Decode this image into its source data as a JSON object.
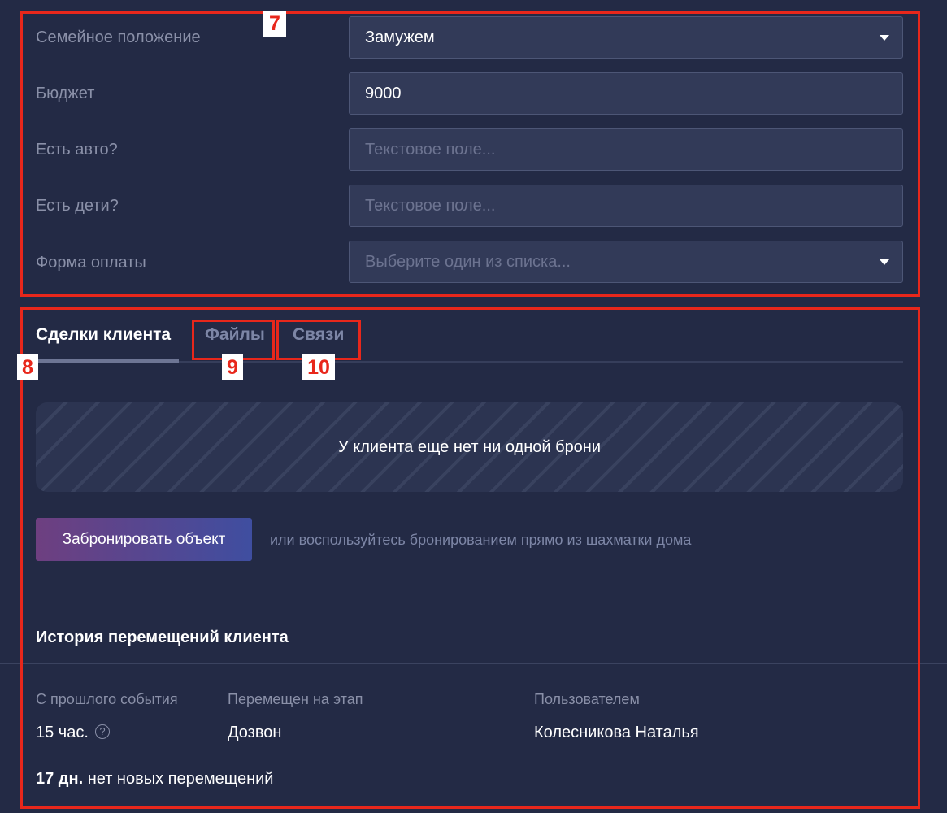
{
  "form": {
    "marital_status": {
      "label": "Семейное положение",
      "value": "Замужем"
    },
    "budget": {
      "label": "Бюджет",
      "value": "9000"
    },
    "has_car": {
      "label": "Есть авто?",
      "placeholder": "Текстовое поле..."
    },
    "has_children": {
      "label": "Есть дети?",
      "placeholder": "Текстовое поле..."
    },
    "payment_form": {
      "label": "Форма оплаты",
      "placeholder": "Выберите один из списка..."
    }
  },
  "tabs": [
    {
      "label": "Сделки клиента",
      "active": true
    },
    {
      "label": "Файлы",
      "active": false
    },
    {
      "label": "Связи",
      "active": false
    }
  ],
  "deals": {
    "empty_text": "У клиента еще нет ни одной брони",
    "book_button": "Забронировать объект",
    "hint": "или воспользуйтесь бронированием прямо из шахматки дома"
  },
  "history": {
    "title": "История перемещений клиента",
    "columns": [
      "С прошлого события",
      "Перемещен на этап",
      "Пользователем"
    ],
    "row": {
      "since": "15 час.",
      "help_icon": "?",
      "stage": "Дозвон",
      "user": "Колесникова Наталья"
    },
    "no_moves_days": "17 дн.",
    "no_moves_text": "нет новых перемещений"
  },
  "annotations": {
    "box7": "7",
    "box8": "8",
    "box9": "9",
    "box10": "10"
  },
  "colors": {
    "background": "#232a45",
    "field": "#323a58",
    "annotation": "#e8271b"
  }
}
